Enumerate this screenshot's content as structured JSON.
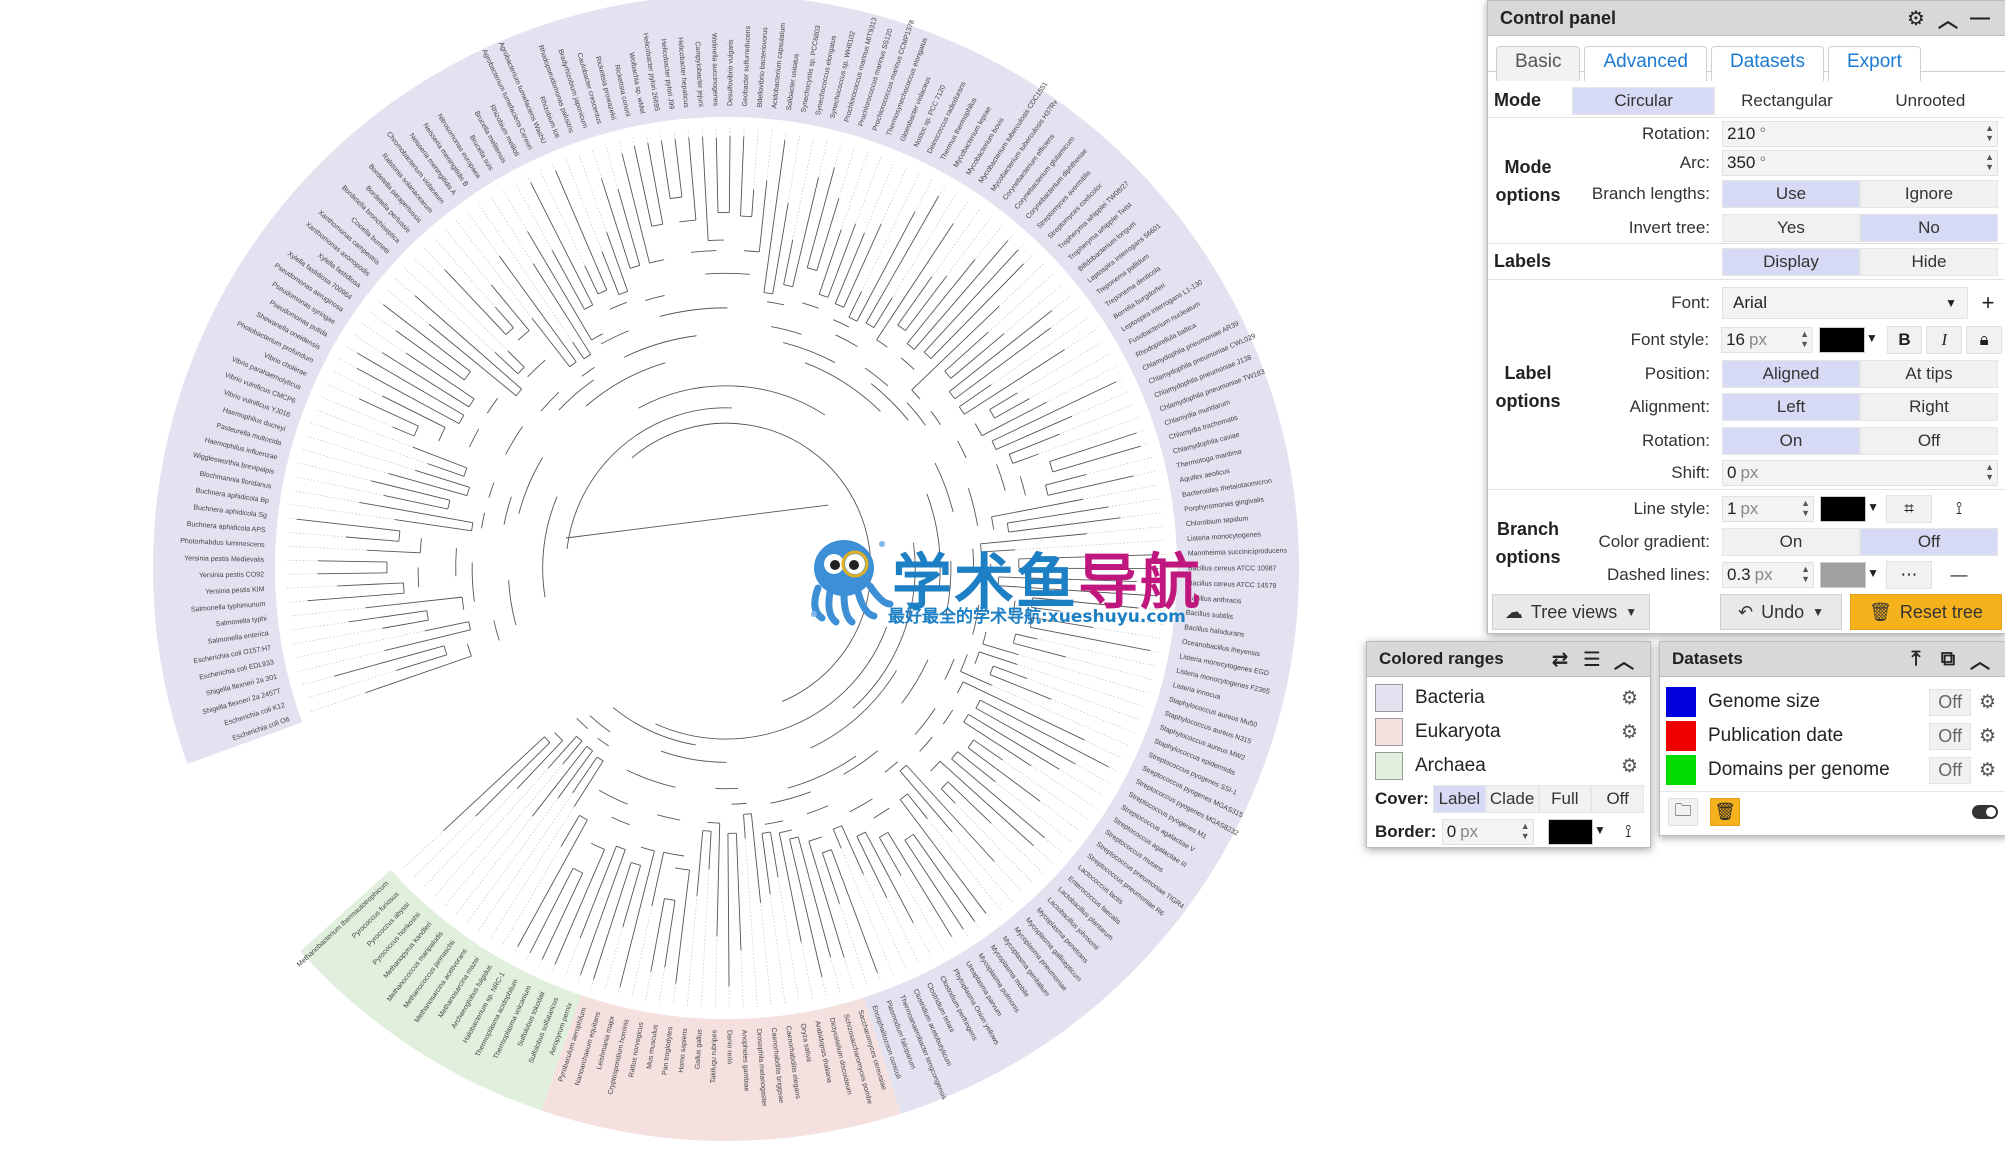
{
  "tree": {
    "ranges": [
      {
        "name": "Bacteria",
        "color": "#e2e2f0"
      },
      {
        "name": "Eukaryota",
        "color": "#f5e0e0"
      },
      {
        "name": "Archaea",
        "color": "#e0f0dc"
      }
    ],
    "labels": [
      "Escherichia coli O6",
      "Escherichia coli K12",
      "Shigella flexneri 2a 2457T",
      "Shigella flexneri 2a 301",
      "Escherichia coli EDL933",
      "Escherichia coli O157:H7",
      "Salmonella enterica",
      "Salmonella typhi",
      "Salmonella typhimurium",
      "Yersinia pestis KIM",
      "Yersinia pestis CO92",
      "Yersinia pestis Medievalis",
      "Photorhabdus luminescens",
      "Buchnera aphidicola APS",
      "Buchnera aphidicola Sg",
      "Buchnera aphidicola Bp",
      "Blochmannia floridanus",
      "Wigglesworthia brevipalpis",
      "Haemophilus influenzae",
      "Pasteurella multocida",
      "Haemophilus ducreyi",
      "Vibrio vulnificus YJ016",
      "Vibrio vulnificus CMCP6",
      "Vibrio parahaemolyticus",
      "Vibrio cholerae",
      "Photobacterium profundum",
      "Shewanella oneidensis",
      "Pseudomonas putida",
      "Pseudomonas syringae",
      "Pseudomonas aeruginosa",
      "Xylella fastidiosa 700964",
      "Xylella fastidiosa",
      "Xanthomonas axonopodis",
      "Xanthomonas campestris",
      "Coxiella burnetii",
      "Bordetella bronchiseptica",
      "Bordetella pertussis",
      "Bordetella parapertussis",
      "Ralstonia solanacearum",
      "Chromobacterium violaceum",
      "Neisseria meningitidis A",
      "Neisseria meningitidis B",
      "Nitrosomonas europaea",
      "Brucella suis",
      "Brucella melitensis",
      "Rhizobium meliloti",
      "Agrobacterium tumefaciens Cereon",
      "Agrobacterium tumefaciens WashU",
      "Rhizobium loti",
      "Rhodopseudomonas palustris",
      "Bradyrhizobium japonicum",
      "Caulobacter crescentus",
      "Rickettsia prowazekii",
      "Rickettsia conorii",
      "Wolbachia sp. wMel",
      "Helicobacter pylori 26695",
      "Helicobacter pylori J99",
      "Helicobacter hepaticus",
      "Campylobacter jejuni",
      "Wolinella succinogenes",
      "Desulfovibrio vulgaris",
      "Geobacter sulfurreducens",
      "Bdellovibrio bacteriovorus",
      "Acidobacterium capsulatum",
      "Solibacter usitatus",
      "Synechocystis sp. PCC6803",
      "Synechococcus elongatus",
      "Synechococcus sp. WH8102",
      "Prochlorococcus marinus MIT9313",
      "Prochlorococcus marinus SS120",
      "Prochlorococcus marinus CCMP1378",
      "Thermosynechococcus elongatus",
      "Gloeobacter violaceus",
      "Nostoc sp. PCC 7120",
      "Deinococcus radiodurans",
      "Thermus thermophilus",
      "Mycobacterium leprae",
      "Mycobacterium bovis",
      "Mycobacterium tuberculosis CDC1551",
      "Mycobacterium tuberculosis H37Rv",
      "Corynebacterium efficiens",
      "Corynebacterium glutamicum",
      "Corynebacterium diphtheriae",
      "Streptomyces avermitilis",
      "Streptomyces coelicolor",
      "Tropheryma whipplei TW08/27",
      "Tropheryma whipplei Twist",
      "Bifidobacterium longum",
      "Leptospira interrogans 56601",
      "Treponema pallidum",
      "Treponema denticola",
      "Borrelia burgdorferi",
      "Leptospira interrogans L1-130",
      "Fusobacterium nucleatum",
      "Rhodopirellula baltica",
      "Chlamydophila pneumoniae AR39",
      "Chlamydophila pneumoniae CWL029",
      "Chlamydophila pneumoniae J138",
      "Chlamydophila pneumoniae TW183",
      "Chlamydia muridarum",
      "Chlamydia trachomatis",
      "Chlamydophila caviae",
      "Thermotoga maritima",
      "Aquifex aeolicus",
      "Bacteroides thetaiotaomicron",
      "Porphyromonas gingivalis",
      "Chlorobium tepidum",
      "Listeria monocytogenes",
      "Mannheimia succiniciproducens",
      "Bacillus cereus ATCC 10987",
      "Bacillus cereus ATCC 14579",
      "Bacillus anthracis",
      "Bacillus subtilis",
      "Bacillus halodurans",
      "Oceanobacillus iheyensis",
      "Listeria monocytogenes EGD",
      "Listeria monocytogenes F2365",
      "Listeria innocua",
      "Staphylococcus aureus Mu50",
      "Staphylococcus aureus N315",
      "Staphylococcus aureus MW2",
      "Staphylococcus epidermidis",
      "Streptococcus pyogenes SSI-1",
      "Streptococcus pyogenes MGAS315",
      "Streptococcus pyogenes MGAS8232",
      "Streptococcus pyogenes M1",
      "Streptococcus agalactiae V",
      "Streptococcus agalactiae III",
      "Streptococcus mutans",
      "Streptococcus pneumoniae TIGR4",
      "Streptococcus pneumoniae R6",
      "Lactococcus lactis",
      "Enterococcus faecalis",
      "Lactobacillus plantarum",
      "Lactobacillus johnsonii",
      "Mycoplasma penetrans",
      "Mycoplasma gallisepticum",
      "Mycoplasma pneumoniae",
      "Mycoplasma genitalium",
      "Mycoplasma mobile",
      "Mycoplasma pulmonis",
      "Ureaplasma parvum",
      "Phytoplasma Onion yellows",
      "Clostridium perfringens",
      "Clostridium tetani",
      "Clostridium acetobutylicum",
      "Thermoanaerobacter tengcongensis",
      "Plasmodium falciparum",
      "Encephalitozoon cuniculi",
      "Saccharomyces cerevisiae",
      "Schizosaccharomyces pombe",
      "Dictyostelium discoideum",
      "Arabidopsis thaliana",
      "Oryza sativa",
      "Caenorhabditis elegans",
      "Caenorhabditis briggsae",
      "Drosophila melanogaster",
      "Anopheles gambiae",
      "Danio rerio",
      "Takifugu rubripes",
      "Gallus gallus",
      "Homo sapiens",
      "Pan troglodytes",
      "Mus musculus",
      "Rattus norvegicus",
      "Cryptosporidium hominis",
      "Leishmania major",
      "Nanoarchaeum equitans",
      "Pyrobaculum aerophilum",
      "Aeropyrum pernix",
      "Sulfolobus solfataricus",
      "Sulfolobus tokodaii",
      "Thermoplasma volcanium",
      "Thermoplasma acidophilum",
      "Halobacterium sp. NRC-1",
      "Archaeoglobus fulgidus",
      "Methanosarcina mazei",
      "Methanosarcina acetivorans",
      "Methanococcus jannaschii",
      "Methanococcus maripaludis",
      "Methanopyrus kandleri",
      "Pyrococcus horikoshii",
      "Pyrococcus abyssi",
      "Pyrococcus furiosus",
      "Methanobacterium thermautotrophicum"
    ]
  },
  "watermark": {
    "title_a": "学术鱼",
    "title_b": "导航",
    "subtitle": "最好最全的学术导航:xueshuyu.com"
  },
  "control_panel": {
    "title": "Control panel",
    "tabs": [
      "Basic",
      "Advanced",
      "Datasets",
      "Export"
    ],
    "mode": {
      "label": "Mode",
      "options": [
        "Circular",
        "Rectangular",
        "Unrooted"
      ],
      "selected": "Circular"
    },
    "mode_options": {
      "label_line1": "Mode",
      "label_line2": "options",
      "rotation_label": "Rotation:",
      "rotation_value": "210",
      "rotation_unit": "°",
      "arc_label": "Arc:",
      "arc_value": "350",
      "arc_unit": "°",
      "branch_lengths_label": "Branch lengths:",
      "branch_use": "Use",
      "branch_ignore": "Ignore",
      "invert_label": "Invert tree:",
      "invert_yes": "Yes",
      "invert_no": "No"
    },
    "labels": {
      "label": "Labels",
      "display": "Display",
      "hide": "Hide"
    },
    "label_options": {
      "label_line1": "Label",
      "label_line2": "options",
      "font_label": "Font:",
      "font_value": "Arial",
      "font_style_label": "Font style:",
      "font_size": "16",
      "font_unit": "px",
      "bold": "B",
      "italic": "I",
      "position_label": "Position:",
      "aligned": "Aligned",
      "at_tips": "At tips",
      "alignment_label": "Alignment:",
      "left": "Left",
      "right": "Right",
      "rotation_label": "Rotation:",
      "on": "On",
      "off": "Off",
      "shift_label": "Shift:",
      "shift_value": "0",
      "shift_unit": "px"
    },
    "branch_options": {
      "label_line1": "Branch",
      "label_line2": "options",
      "line_style_label": "Line style:",
      "line_width": "1",
      "line_unit": "px",
      "gradient_label": "Color gradient:",
      "on": "On",
      "off": "Off",
      "dashed_label": "Dashed lines:",
      "dashed_value": "0.3",
      "dashed_unit": "px"
    },
    "footer": {
      "tree_views": "Tree views",
      "undo": "Undo",
      "reset": "Reset tree"
    },
    "colors": {
      "label_color": "#000000",
      "line_color": "#000000",
      "dashed_color": "#a0a0a0"
    }
  },
  "colored_ranges": {
    "title": "Colored ranges",
    "items": [
      {
        "name": "Bacteria",
        "color": "#e2e2f0"
      },
      {
        "name": "Eukaryota",
        "color": "#f5e0e0"
      },
      {
        "name": "Archaea",
        "color": "#e0f0dc"
      }
    ],
    "cover_label": "Cover:",
    "cover_options": [
      "Label",
      "Clade",
      "Full",
      "Off"
    ],
    "cover_selected": "Label",
    "border_label": "Border:",
    "border_value": "0",
    "border_unit": "px"
  },
  "datasets": {
    "title": "Datasets",
    "items": [
      {
        "name": "Genome size",
        "color": "#0000dd",
        "state": "Off"
      },
      {
        "name": "Publication date",
        "color": "#ee0000",
        "state": "Off"
      },
      {
        "name": "Domains per genome",
        "color": "#00dd00",
        "state": "Off"
      }
    ]
  }
}
